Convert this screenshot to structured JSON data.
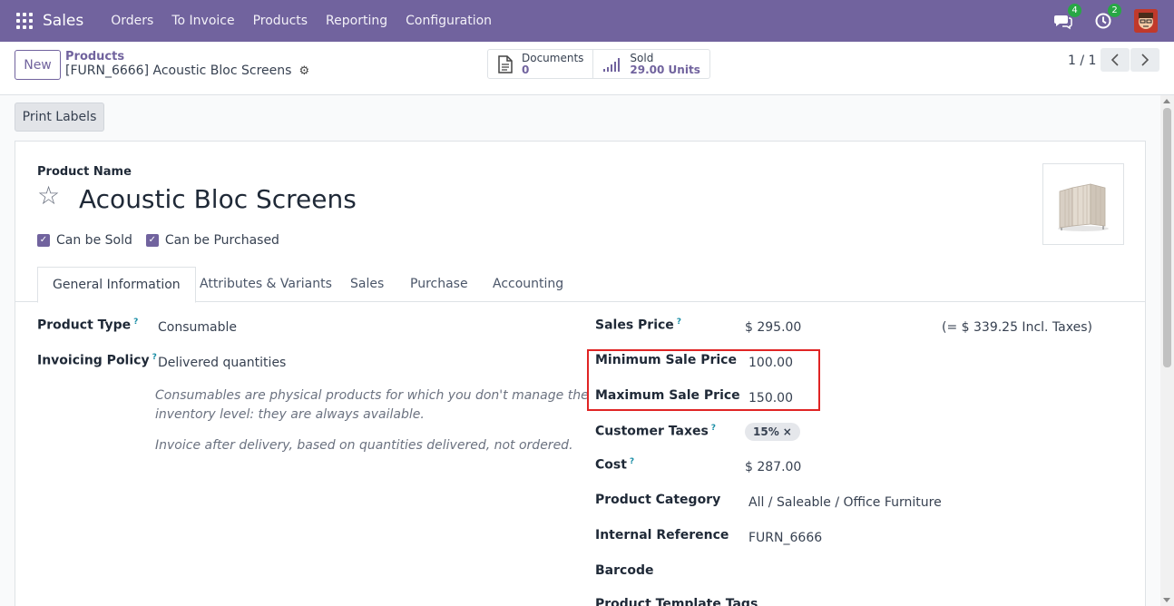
{
  "navbar": {
    "brand": "Sales",
    "menu": [
      "Orders",
      "To Invoice",
      "Products",
      "Reporting",
      "Configuration"
    ],
    "messages_count": "4",
    "activities_count": "2",
    "color": "#71639e"
  },
  "control": {
    "new_label": "New",
    "breadcrumb_parent": "Products",
    "breadcrumb_current": "[FURN_6666] Acoustic Bloc Screens",
    "documents_label": "Documents",
    "documents_value": "0",
    "sold_label": "Sold",
    "sold_value": "29.00 Units",
    "pager": "1 / 1"
  },
  "actions": {
    "print_labels": "Print Labels"
  },
  "product": {
    "name_label": "Product Name",
    "name": "Acoustic Bloc Screens",
    "can_be_sold": "Can be Sold",
    "can_be_purchased": "Can be Purchased"
  },
  "tabs": [
    "General Information",
    "Attributes & Variants",
    "Sales",
    "Purchase",
    "Accounting"
  ],
  "left_fields": {
    "product_type_label": "Product Type",
    "product_type": "Consumable",
    "invoicing_policy_label": "Invoicing Policy",
    "invoicing_policy": "Delivered quantities",
    "help_consumable_1": "Consumables are physical products for which you don't manage the",
    "help_consumable_2": "inventory level: they are always available.",
    "help_invoice": "Invoice after delivery, based on quantities delivered, not ordered."
  },
  "right_fields": {
    "sales_price_label": "Sales Price",
    "sales_price": "$ 295.00",
    "incl_taxes": "(= $ 339.25 Incl. Taxes)",
    "min_price_label": "Minimum Sale Price",
    "min_price": "100.00",
    "max_price_label": "Maximum Sale Price",
    "max_price": "150.00",
    "customer_taxes_label": "Customer Taxes",
    "customer_tax_tag": "15%",
    "cost_label": "Cost",
    "cost": "$ 287.00",
    "category_label": "Product Category",
    "category": "All / Saleable / Office Furniture",
    "internal_ref_label": "Internal Reference",
    "internal_ref": "FURN_6666",
    "barcode_label": "Barcode",
    "template_tags_label": "Product Template Tags"
  }
}
